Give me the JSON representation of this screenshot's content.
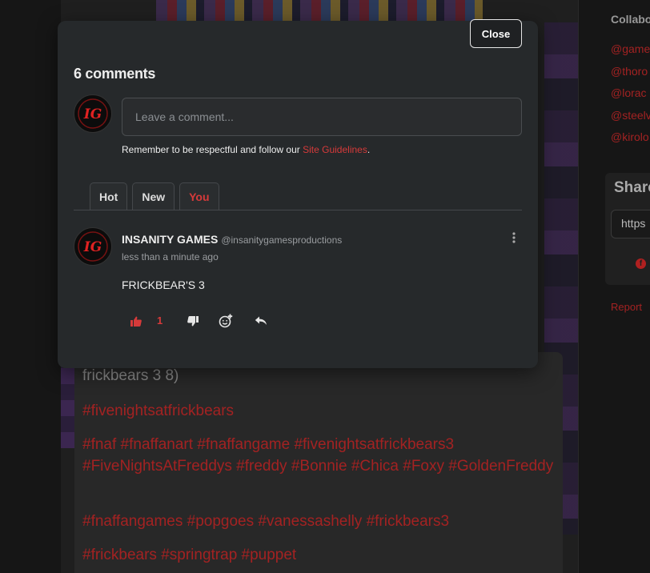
{
  "modal": {
    "close_label": "Close",
    "comment_count": "6 comments",
    "input_placeholder": "Leave a comment...",
    "guidelines_prefix": "Remember to be respectful and follow our ",
    "guidelines_link": "Site Guidelines",
    "guidelines_suffix": ".",
    "tabs": [
      {
        "label": "Hot",
        "active": false
      },
      {
        "label": "New",
        "active": false
      },
      {
        "label": "You",
        "active": true
      }
    ],
    "comment": {
      "author": "INSANITY GAMES",
      "handle": "@insanitygamesproductions",
      "time": "less than a minute ago",
      "text": "FRICKBEAR'S 3",
      "likes": "1"
    },
    "avatar_text": "IG"
  },
  "description": {
    "first_line": "frickbears 3 8)",
    "tags": [
      "#fivenightsatfrickbears",
      "#fnaf #fnaffanart #fnaffangame #fivenightsatfrickbears3 #FiveNightsAtFreddys #freddy #Bonnie #Chica #Foxy #GoldenFreddy",
      "#fnaffangames #popgoes #vanessashelly #frickbears3",
      "#frickbears #springtrap #puppet"
    ]
  },
  "sidebar": {
    "collab_title": "Collabo",
    "collaborators": [
      "@game",
      "@thoro",
      "@lorac",
      "@steelv",
      "@kirolo"
    ],
    "share_title": "Share",
    "share_url": "https",
    "report_label": "Report"
  },
  "colors": {
    "accent": "#d63a3a",
    "modal_bg": "#26292b",
    "page_bg": "#181818"
  }
}
